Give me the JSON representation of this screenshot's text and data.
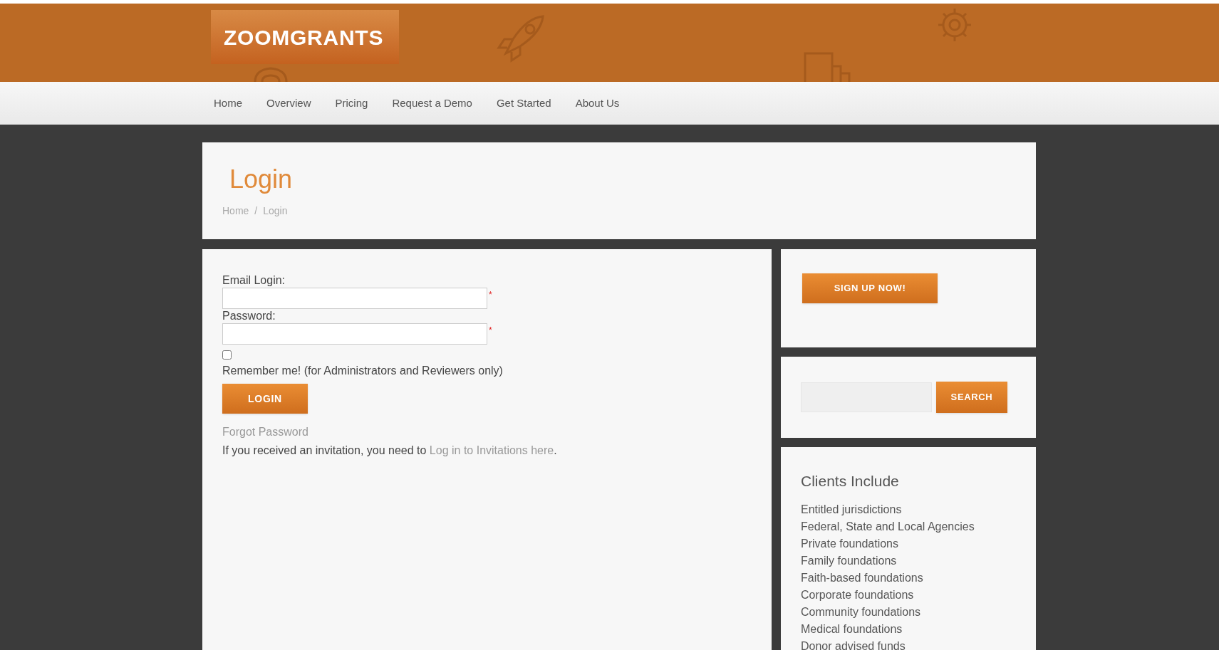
{
  "logo": "ZOOMGRANTS",
  "nav": [
    {
      "label": "Home"
    },
    {
      "label": "Overview"
    },
    {
      "label": "Pricing"
    },
    {
      "label": "Request a Demo"
    },
    {
      "label": "Get Started"
    },
    {
      "label": "About Us"
    }
  ],
  "page_title": "Login",
  "breadcrumb": [
    "Home",
    "/",
    "Login"
  ],
  "form": {
    "fields": [
      {
        "label": "Email Login:",
        "required_mark": "*"
      },
      {
        "label": "Password:",
        "required_mark": "*"
      }
    ],
    "remember": {
      "checked": false,
      "label": "Remember me! (for Administrators and Reviewers only)"
    },
    "button": "LOGIN",
    "forgot_link": "Forgot Password",
    "invitation_text": "If you received an invitation, you need to ",
    "invitation_link": "Log in to Invitations here",
    "invitation_end": "."
  },
  "signup_button": "SIGN UP NOW!",
  "search_button": "SEARCH",
  "clients": {
    "title": "Clients Include",
    "items": [
      "Entitled jurisdictions",
      "Federal, State and Local Agencies",
      "Private foundations",
      "Family foundations",
      "Faith-based foundations",
      "Corporate foundations",
      "Community foundations",
      "Medical foundations",
      "Donor advised funds"
    ]
  }
}
